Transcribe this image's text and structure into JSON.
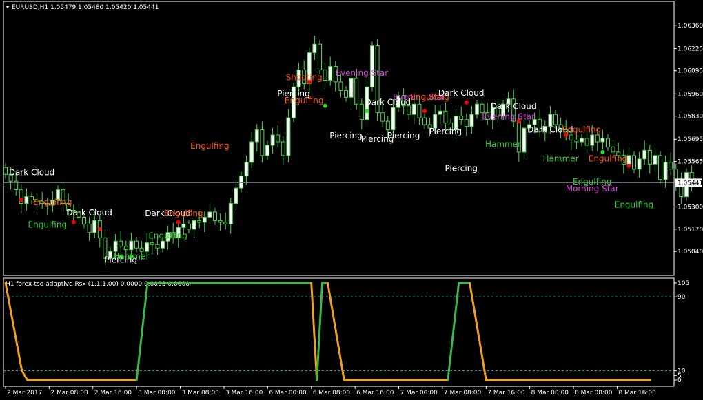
{
  "colors": {
    "bg": "#000000",
    "frame": "#ffffff",
    "bull_fill": "#ffffff",
    "bull_edge": "#4dd94d",
    "bear_fill": "#000000",
    "bear_edge": "#4dd94d",
    "dotted": "#20b2aa",
    "osc_up": "#3cb84a",
    "osc_down": "#f0a020",
    "bid_line": "#708090",
    "pattern_white": "#ffffff",
    "pattern_orange": "#ff5010",
    "pattern_green": "#33cc33",
    "pattern_magenta": "#e040e0",
    "marker_red": "#ff0000",
    "marker_green": "#22dd22"
  },
  "header": {
    "symbol_info": "EURUSD,H1  1.05479 1.05480 1.05420 1.05441",
    "indicator_info": "H1 forex-tsd adaptive Rsx (1,1,1.00) 0.0000 0.0000 0.0000"
  },
  "chart_data": [
    {
      "type": "candlestick",
      "symbol": "EURUSD",
      "timeframe": "H1",
      "last_price": "1.05441",
      "ylim": [
        1.049,
        1.065
      ],
      "y_ticks": [
        "1.06360",
        "1.06225",
        "1.06095",
        "1.05960",
        "1.05830",
        "1.05695",
        "1.05565",
        "1.05300",
        "1.05170",
        "1.05040"
      ],
      "x_ticks": [
        "2 Mar 2017",
        "2 Mar 08:00",
        "2 Mar 16:00",
        "3 Mar 00:00",
        "3 Mar 08:00",
        "3 Mar 16:00",
        "6 Mar 00:00",
        "6 Mar 08:00",
        "6 Mar 16:00",
        "7 Mar 00:00",
        "7 Mar 08:00",
        "7 Mar 16:00",
        "8 Mar 00:00",
        "8 Mar 08:00",
        "8 Mar 16:00"
      ],
      "x_range": [
        "2 Mar 2017 00:00",
        "8 Mar 2017 22:00"
      ],
      "close_series": [
        1.0549,
        1.0545,
        1.054,
        1.0532,
        1.0536,
        1.0534,
        1.0533,
        1.0532,
        1.0531,
        1.0534,
        1.054,
        1.0532,
        1.0528,
        1.0527,
        1.0524,
        1.052,
        1.0515,
        1.0522,
        1.0512,
        1.05,
        1.0504,
        1.051,
        1.0507,
        1.0505,
        1.051,
        1.0506,
        1.0504,
        1.0509,
        1.0508,
        1.0506,
        1.051,
        1.0515,
        1.0512,
        1.0518,
        1.052,
        1.0517,
        1.0522,
        1.0521,
        1.0524,
        1.0527,
        1.0522,
        1.0521,
        1.052,
        1.0532,
        1.0541,
        1.0548,
        1.0556,
        1.0568,
        1.0575,
        1.056,
        1.0566,
        1.0572,
        1.0568,
        1.056,
        1.0582,
        1.06,
        1.061,
        1.0602,
        1.062,
        1.0625,
        1.061,
        1.0604,
        1.0612,
        1.0603,
        1.0598,
        1.0594,
        1.0605,
        1.059,
        1.0581,
        1.06,
        1.0624,
        1.0585,
        1.058,
        1.0575,
        1.0588,
        1.0595,
        1.0589,
        1.0584,
        1.059,
        1.0582,
        1.0578,
        1.0576,
        1.0584,
        1.0586,
        1.0579,
        1.0575,
        1.0583,
        1.0581,
        1.0577,
        1.0584,
        1.059,
        1.0585,
        1.0581,
        1.0588,
        1.0583,
        1.059,
        1.0593,
        1.058,
        1.0562,
        1.0576,
        1.0578,
        1.0581,
        1.0574,
        1.0577,
        1.0584,
        1.0578,
        1.0575,
        1.0572,
        1.0569,
        1.0568,
        1.057,
        1.0566,
        1.0572,
        1.0568,
        1.057,
        1.0565,
        1.0562,
        1.056,
        1.0555,
        1.056,
        1.0552,
        1.0558,
        1.0563,
        1.0555,
        1.056,
        1.0546,
        1.0556,
        1.0552,
        1.0545,
        1.0536,
        1.055,
        1.0544
      ],
      "patterns": [
        {
          "text": "Dark Cloud",
          "i": 5,
          "price": 1.05485,
          "color": "white"
        },
        {
          "text": "Engulfing",
          "i": 9,
          "price": 1.0531,
          "color": "orange"
        },
        {
          "text": "Engulfing",
          "i": 8,
          "price": 1.0518,
          "color": "green"
        },
        {
          "text": "Dark Cloud",
          "i": 16,
          "price": 1.0525,
          "color": "white"
        },
        {
          "text": "Piercing",
          "i": 22,
          "price": 1.04975,
          "color": "white"
        },
        {
          "text": "Hammer",
          "i": 24,
          "price": 1.04995,
          "color": "green"
        },
        {
          "text": "Dark Cloud",
          "i": 31,
          "price": 1.05245,
          "color": "white"
        },
        {
          "text": "Engulfing",
          "i": 34,
          "price": 1.05245,
          "color": "orange"
        },
        {
          "text": "Engulfing",
          "i": 31,
          "price": 1.05115,
          "color": "green"
        },
        {
          "text": "Engulfing",
          "i": 39,
          "price": 1.0564,
          "color": "orange"
        },
        {
          "text": "Shooting",
          "i": 57,
          "price": 1.0604,
          "color": "orange"
        },
        {
          "text": "Piercing",
          "i": 55,
          "price": 1.05945,
          "color": "white"
        },
        {
          "text": "Engulfing",
          "i": 57,
          "price": 1.05905,
          "color": "orange"
        },
        {
          "text": "Evening Star",
          "i": 68,
          "price": 1.06065,
          "color": "magenta"
        },
        {
          "text": "Dark Cloud",
          "i": 73,
          "price": 1.05895,
          "color": "white"
        },
        {
          "text": "Evening Star",
          "i": 79,
          "price": 1.05925,
          "color": "magenta"
        },
        {
          "text": "Engulfing",
          "i": 81,
          "price": 1.05925,
          "color": "orange"
        },
        {
          "text": "Piercing",
          "i": 65,
          "price": 1.057,
          "color": "white"
        },
        {
          "text": "Piercing",
          "i": 71,
          "price": 1.0568,
          "color": "white"
        },
        {
          "text": "Piercing",
          "i": 76,
          "price": 1.057,
          "color": "white"
        },
        {
          "text": "Piercing",
          "i": 84,
          "price": 1.05725,
          "color": "white"
        },
        {
          "text": "Dark Cloud",
          "i": 87,
          "price": 1.0595,
          "color": "white"
        },
        {
          "text": "Piercing",
          "i": 87,
          "price": 1.0551,
          "color": "white"
        },
        {
          "text": "Dark Cloud",
          "i": 97,
          "price": 1.0587,
          "color": "white"
        },
        {
          "text": "Evening Star",
          "i": 96,
          "price": 1.0581,
          "color": "magenta"
        },
        {
          "text": "Hammer",
          "i": 95,
          "price": 1.0565,
          "color": "green"
        },
        {
          "text": "Dark Cloud",
          "i": 104,
          "price": 1.05735,
          "color": "white"
        },
        {
          "text": "Engulfing",
          "i": 110,
          "price": 1.05735,
          "color": "orange"
        },
        {
          "text": "Hammer",
          "i": 106,
          "price": 1.05565,
          "color": "green"
        },
        {
          "text": "Engulfing",
          "i": 115,
          "price": 1.05565,
          "color": "orange"
        },
        {
          "text": "Engulfing",
          "i": 112,
          "price": 1.0543,
          "color": "green"
        },
        {
          "text": "Morning Star",
          "i": 112,
          "price": 1.0539,
          "color": "magenta"
        },
        {
          "text": "Engulfing",
          "i": 120,
          "price": 1.05295,
          "color": "green"
        }
      ],
      "markers_red": [
        [
          3,
          1.0534
        ],
        [
          13,
          1.0521
        ],
        [
          18,
          1.0517
        ],
        [
          33,
          1.0521
        ],
        [
          58,
          1.0603
        ],
        [
          80,
          1.0586
        ],
        [
          88,
          1.0591
        ],
        [
          98,
          1.058
        ],
        [
          107,
          1.0572
        ],
        [
          119,
          1.0554
        ]
      ],
      "markers_green": [
        [
          22,
          1.0501
        ],
        [
          24,
          1.0501
        ],
        [
          61,
          1.0589
        ],
        [
          69,
          1.0586
        ],
        [
          114,
          1.0562
        ]
      ]
    },
    {
      "type": "line",
      "name": "H1 forex-tsd adaptive Rsx (1,1,1.00)",
      "ylim": [
        0,
        105
      ],
      "y_ticks": [
        "105",
        "90",
        "10",
        "5",
        "0"
      ],
      "levels": [
        90,
        10
      ],
      "x": [
        "2 Mar 00:00",
        "2 Mar 03:00",
        "2 Mar 04:00",
        "3 Mar 00:00",
        "3 Mar 02:00",
        "6 Mar 08:00",
        "6 Mar 09:00",
        "6 Mar 10:00",
        "6 Mar 11:00",
        "6 Mar 14:00",
        "6 Mar 16:00",
        "7 Mar 09:00",
        "7 Mar 11:00",
        "7 Mar 13:00",
        "7 Mar 16:00",
        "8 Mar 22:00"
      ],
      "values": [
        105,
        10,
        0,
        0,
        105,
        105,
        0,
        105,
        105,
        0,
        0,
        0,
        105,
        105,
        0,
        0
      ]
    }
  ]
}
